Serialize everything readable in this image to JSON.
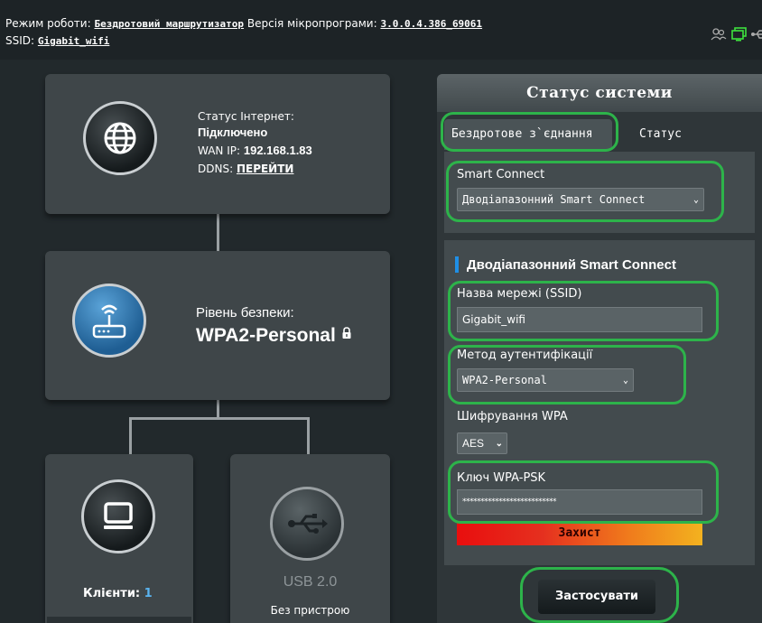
{
  "topbar": {
    "mode_label": "Режим роботи:",
    "mode_value": "Бездротовий маршрутизатор",
    "firmware_label": "Версія мікропрограми:",
    "firmware_value": "3.0.0.4.386_69061",
    "ssid_label": "SSID:",
    "ssid_value": "Gigabit_wifi",
    "icons": [
      "users-icon",
      "monitor-icon",
      "usb-icon"
    ]
  },
  "internet_card": {
    "status_label": "Статус Інтернет:",
    "status_value": "Підключено",
    "wan_label": "WAN IP:",
    "wan_value": "192.168.1.83",
    "ddns_label": "DDNS:",
    "ddns_link": "ПЕРЕЙТИ",
    "icon": "globe-icon"
  },
  "security_card": {
    "label": "Рівень безпеки:",
    "value": "WPA2-Personal",
    "icon": "router-icon"
  },
  "clients_card": {
    "label": "Клієнти:",
    "count": "1",
    "icon": "computer-icon"
  },
  "usb_card": {
    "label": "USB 2.0",
    "status": "Без пристрою",
    "icon": "usb-icon"
  },
  "panel": {
    "title": "Статус системи",
    "tabs": [
      {
        "label": "Бездротове з`єднання",
        "active": true
      },
      {
        "label": "Статус",
        "active": false
      }
    ],
    "smart_connect_label": "Smart Connect",
    "smart_connect_value": "Дводіапазонний Smart Connect",
    "section_title": "Дводіапазонний Smart Connect",
    "ssid_label": "Назва мережі (SSID)",
    "ssid_value": "Gigabit_wifi",
    "auth_label": "Метод аутентифікації",
    "auth_value": "WPA2-Personal",
    "encryption_label": "Шифрування WPA",
    "encryption_value": "AES",
    "key_label": "Ключ WPA-PSK",
    "key_value": "**************************",
    "strength_label": "Захист",
    "apply_label": "Застосувати"
  },
  "colors": {
    "background": "#22292c",
    "card": "#3f4649",
    "highlight": "#2db34a",
    "accent_blue": "#1f8fe6",
    "clients_count": "#5ab4f0"
  }
}
